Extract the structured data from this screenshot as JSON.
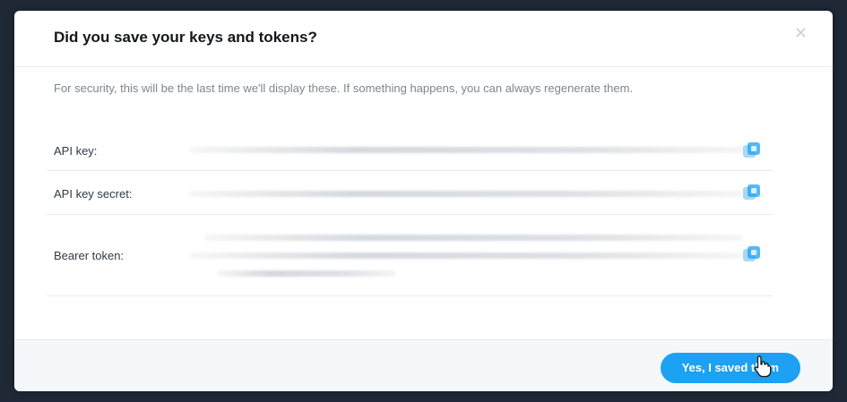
{
  "dialog": {
    "title": "Did you save your keys and tokens?",
    "close_icon": "close-icon",
    "description": "For security, this will be the last time we'll display these. If something happens, you can always regenerate them."
  },
  "credentials": [
    {
      "label": "API key:",
      "value_state": "redacted",
      "icon": "copy-icon"
    },
    {
      "label": "API key secret:",
      "value_state": "redacted",
      "icon": "copy-icon"
    },
    {
      "label": "Bearer token:",
      "value_state": "redacted",
      "icon": "copy-icon"
    }
  ],
  "footer": {
    "confirm_label": "Yes, I saved them"
  },
  "colors": {
    "accent": "#1da1f2",
    "title": "#14171a",
    "muted": "#7c8790",
    "divider": "#e6ecf0"
  }
}
